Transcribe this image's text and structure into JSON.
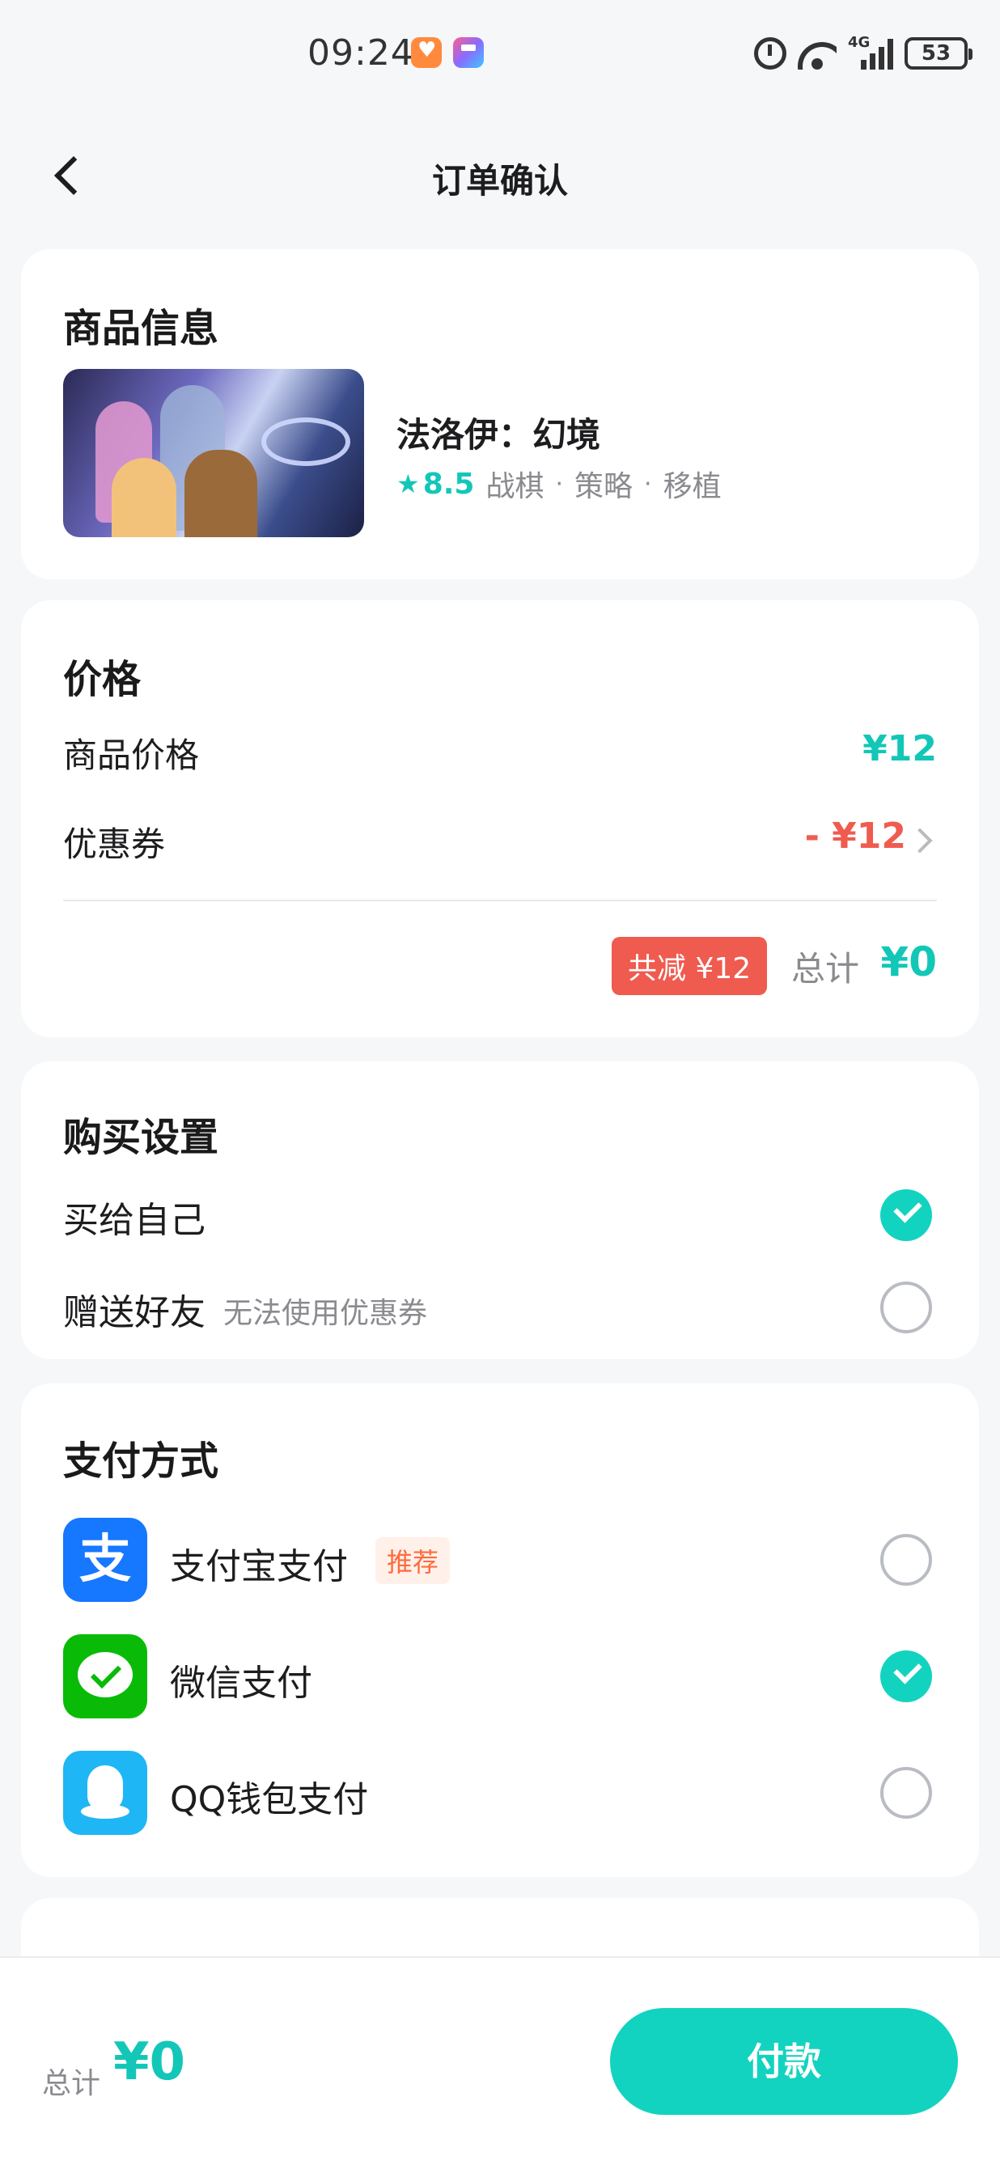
{
  "status_bar": {
    "time": "09:24",
    "network": "4G",
    "battery": "53"
  },
  "header": {
    "title": "订单确认"
  },
  "product": {
    "section_title": "商品信息",
    "name": "法洛伊：幻境",
    "score": "8.5",
    "tags": [
      "战棋",
      "策略",
      "移植"
    ]
  },
  "price": {
    "section_title": "价格",
    "item_label": "商品价格",
    "item_value": "¥12",
    "coupon_label": "优惠券",
    "coupon_value": "- ¥12",
    "discount_badge": "共减 ¥12",
    "total_label": "总计",
    "total_value": "¥0"
  },
  "purchase": {
    "section_title": "购买设置",
    "options": [
      {
        "label": "买给自己",
        "note": "",
        "selected": true
      },
      {
        "label": "赠送好友",
        "note": "无法使用优惠券",
        "selected": false
      }
    ]
  },
  "payment": {
    "section_title": "支付方式",
    "methods": [
      {
        "label": "支付宝支付",
        "tag": "推荐",
        "icon": "alipay-icon",
        "icon_glyph": "支",
        "selected": false
      },
      {
        "label": "微信支付",
        "tag": "",
        "icon": "wechat-pay-icon",
        "selected": true
      },
      {
        "label": "QQ钱包支付",
        "tag": "",
        "icon": "qq-wallet-icon",
        "selected": false
      }
    ]
  },
  "bottom_bar": {
    "total_label": "总计",
    "total_value": "¥0",
    "pay_button": "付款"
  },
  "colors": {
    "accent": "#12d3c0",
    "price": "#12c7b8",
    "discount": "#f05b4f",
    "background": "#f6f7f9"
  }
}
